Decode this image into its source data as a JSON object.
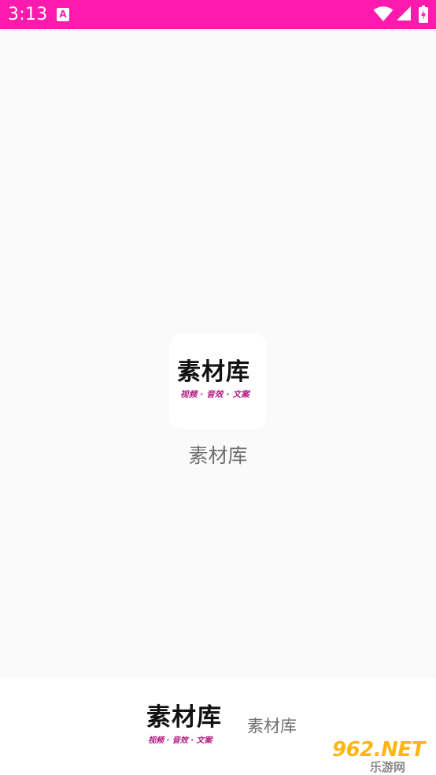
{
  "status_bar": {
    "time": "3:13",
    "notification_glyph": "A",
    "icons": [
      "a-notification-icon",
      "wifi-icon",
      "signal-icon",
      "battery-icon"
    ],
    "background": "#ff1aae"
  },
  "splash": {
    "logo_title": "素材库",
    "logo_tagline": "视频 · 音效 · 文案",
    "app_name": "素材库",
    "background": "#fafafa"
  },
  "bottom_brand": {
    "logo_title": "素材库",
    "logo_tagline": "视频 · 音效 · 文案",
    "app_name": "素材库"
  },
  "watermark": {
    "line1": "962.NET",
    "line2": "乐游网",
    "accent": "#ffb516"
  }
}
